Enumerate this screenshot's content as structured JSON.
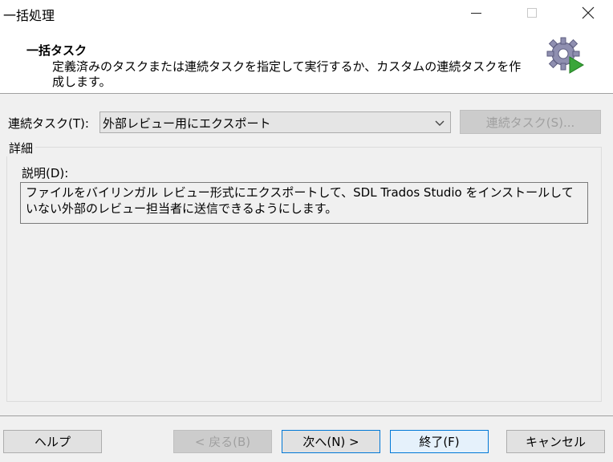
{
  "window": {
    "title": "一括処理"
  },
  "header": {
    "title": "一括タスク",
    "description": "定義済みのタスクまたは連続タスクを指定して実行するか、カスタムの連続タスクを作成します。",
    "icon": "gear-play-icon"
  },
  "sequence": {
    "label": "連続タスク(T):",
    "selected": "外部レビュー用にエクスポート",
    "button_label": "連続タスク(S)..."
  },
  "details": {
    "legend": "詳細",
    "description_label": "説明(D):",
    "description_text": "ファイルをバイリンガル レビュー形式にエクスポートして、SDL Trados Studio をインストールしていない外部のレビュー担当者に送信できるようにします。"
  },
  "footer": {
    "help_label": "ヘルプ",
    "back_label": "< 戻る(B)",
    "next_label": "次へ(N) >",
    "finish_label": "終了(F)",
    "cancel_label": "キャンセル"
  },
  "colors": {
    "accent": "#0078d7",
    "gear_play": "#3aa63a"
  }
}
